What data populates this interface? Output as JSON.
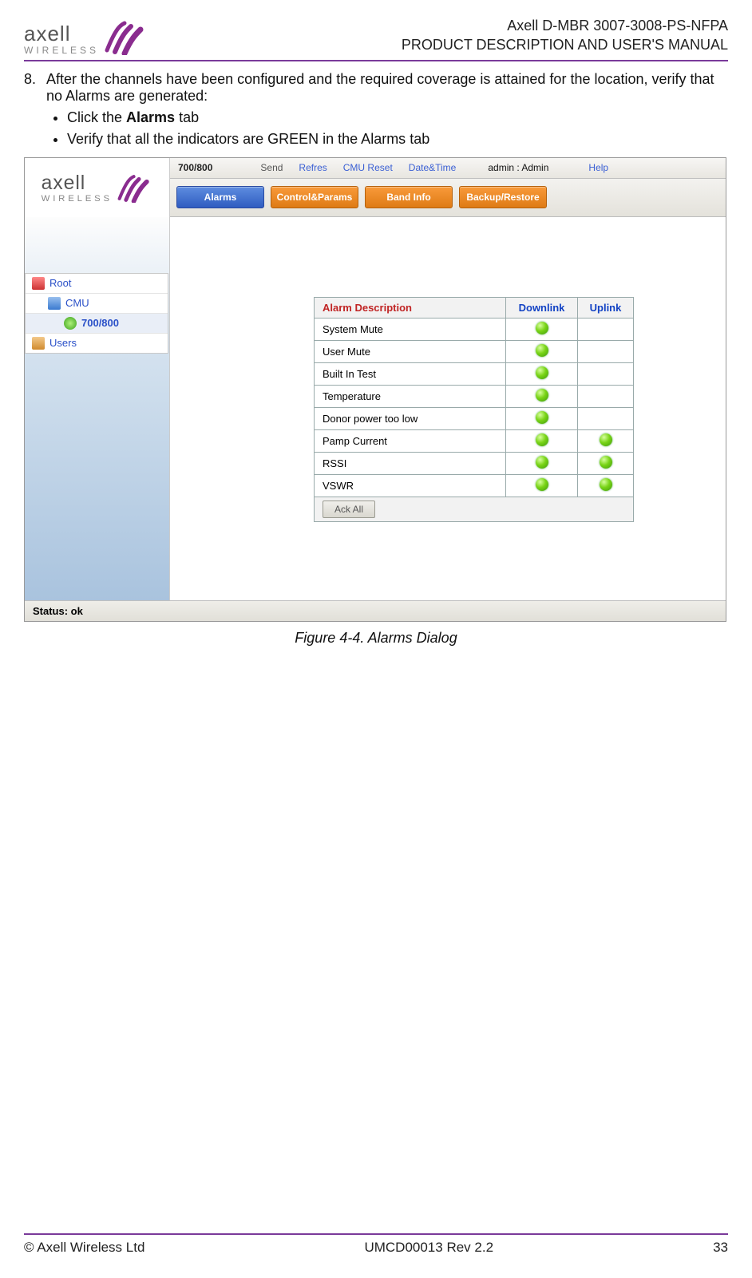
{
  "header": {
    "logo_top": "axell",
    "logo_bottom": "WIRELESS",
    "right_line1": "Axell D-MBR 3007-3008-PS-NFPA",
    "right_line2": "PRODUCT DESCRIPTION AND USER'S MANUAL"
  },
  "body": {
    "step_number": "8.",
    "step_text": "After the channels have been configured and the required coverage is attained for the location, verify that no Alarms are generated:",
    "bullets": [
      {
        "pre": "Click the ",
        "bold": "Alarms",
        "post": " tab"
      },
      {
        "pre": "Verify that all the indicators are GREEN in the Alarms tab",
        "bold": "",
        "post": ""
      }
    ]
  },
  "screenshot": {
    "menu": {
      "band": "700/800",
      "send": "Send",
      "refresh": "Refres",
      "cmu_reset": "CMU Reset",
      "datetime": "Date&Time",
      "admin": "admin : Admin",
      "help": "Help"
    },
    "tabs": {
      "alarms": "Alarms",
      "control": "Control&Params",
      "band_info": "Band Info",
      "backup": "Backup/Restore"
    },
    "tree": {
      "root": "Root",
      "cmu": "CMU",
      "band": "700/800",
      "users": "Users"
    },
    "alarm_headers": {
      "desc": "Alarm Description",
      "downlink": "Downlink",
      "uplink": "Uplink"
    },
    "alarm_rows": [
      {
        "desc": "System Mute",
        "dl": true,
        "ul": false
      },
      {
        "desc": "User Mute",
        "dl": true,
        "ul": false
      },
      {
        "desc": "Built In Test",
        "dl": true,
        "ul": false
      },
      {
        "desc": "Temperature",
        "dl": true,
        "ul": false
      },
      {
        "desc": "Donor power too low",
        "dl": true,
        "ul": false
      },
      {
        "desc": "Pamp Current",
        "dl": true,
        "ul": true
      },
      {
        "desc": "RSSI",
        "dl": true,
        "ul": true
      },
      {
        "desc": "VSWR",
        "dl": true,
        "ul": true
      }
    ],
    "ack_button": "Ack All",
    "status": "Status: ok"
  },
  "figure_caption": "Figure 4-4. Alarms Dialog",
  "footer": {
    "left": "© Axell Wireless Ltd",
    "center": "UMCD00013 Rev 2.2",
    "right": "33"
  }
}
